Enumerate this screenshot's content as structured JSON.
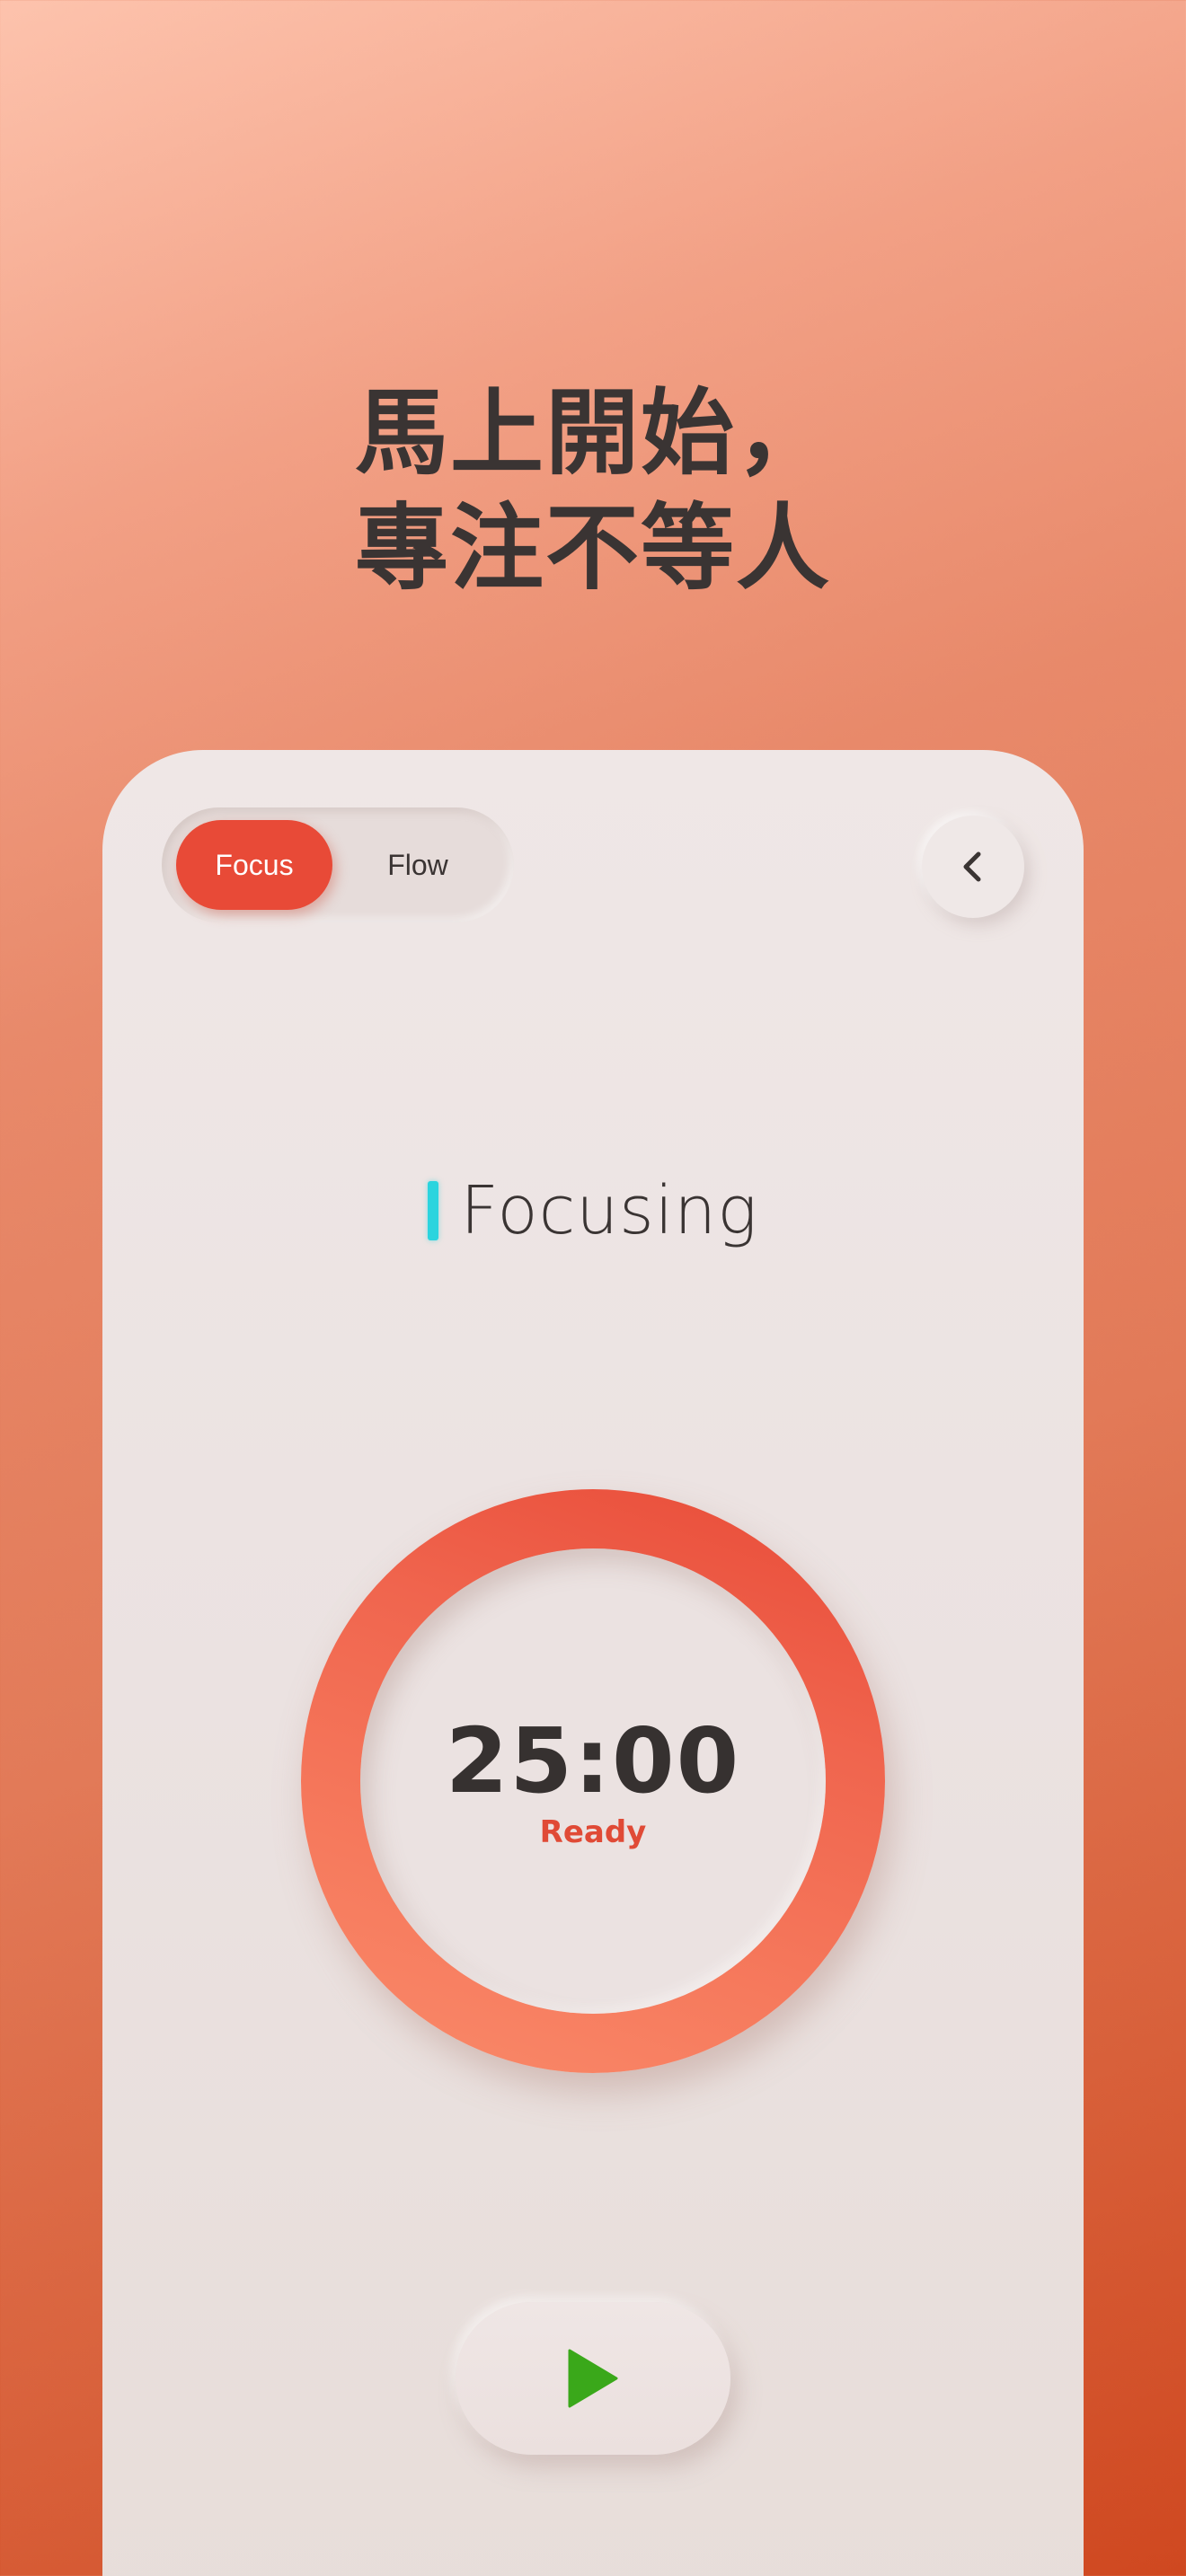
{
  "headline": {
    "line1": "馬上開始，",
    "line2": "專注不等人"
  },
  "mode_toggle": {
    "active_label": "Focus",
    "inactive_label": "Flow"
  },
  "back_button": {
    "icon": "chevron-left-icon"
  },
  "status": {
    "label": "Focusing",
    "indicator_color": "#2bd4de"
  },
  "timer": {
    "time": "25:00",
    "state": "Ready",
    "ring_color": "#e84a37"
  },
  "controls": {
    "play_icon": "play-icon",
    "play_color": "#3aa81a"
  }
}
